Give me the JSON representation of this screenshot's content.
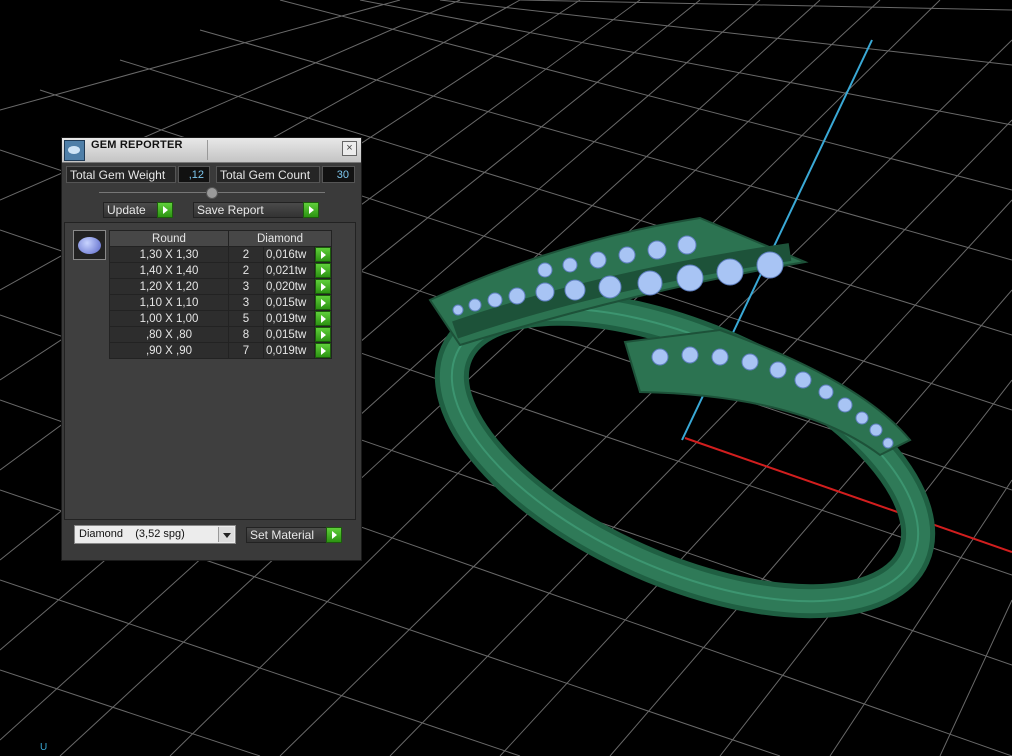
{
  "panel": {
    "title": "GEM REPORTER",
    "close_glyph": "×",
    "total_weight_label": "Total Gem Weight",
    "total_weight_value": ",12",
    "total_count_label": "Total Gem Count",
    "total_count_value": "30",
    "update_label": "Update",
    "save_report_label": "Save Report",
    "table": {
      "headers": [
        "Round",
        "Diamond"
      ],
      "rows": [
        {
          "size": "1,30 X 1,30",
          "count": "2",
          "weight": "0,016tw"
        },
        {
          "size": "1,40 X 1,40",
          "count": "2",
          "weight": "0,021tw"
        },
        {
          "size": "1,20 X 1,20",
          "count": "3",
          "weight": "0,020tw"
        },
        {
          "size": "1,10 X 1,10",
          "count": "3",
          "weight": "0,015tw"
        },
        {
          "size": "1,00 X 1,00",
          "count": "5",
          "weight": "0,019tw"
        },
        {
          "size": ",80 X ,80",
          "count": "8",
          "weight": "0,015tw"
        },
        {
          "size": ",90 X ,90",
          "count": "7",
          "weight": "0,019tw"
        }
      ]
    },
    "material_select": "Diamond    (3,52 spg)",
    "set_material_label": "Set Material"
  },
  "viewport": {
    "axis_label": "U",
    "colors": {
      "background": "#000000",
      "grid": "#9a9a9a",
      "x_axis": "#d21e1e",
      "y_axis": "#3aa9d6",
      "metal": "#2f7a58",
      "gems": "#a8c4f4"
    }
  }
}
